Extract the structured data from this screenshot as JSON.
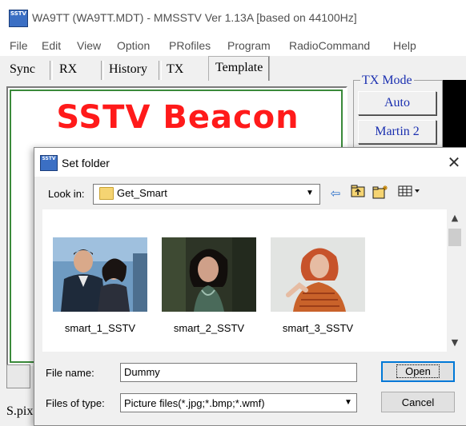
{
  "window": {
    "title": "WA9TT (WA9TT.MDT) - MMSSTV Ver 1.13A [based on 44100Hz]",
    "icon_text": "SSTV"
  },
  "menu": [
    "File",
    "Edit",
    "View",
    "Option",
    "PRofiles",
    "Program",
    "RadioCommand",
    "Help"
  ],
  "tabs": [
    "Sync",
    "RX",
    "History",
    "TX",
    "Template"
  ],
  "active_tab": "Template",
  "template": {
    "beacon_text": "SSTV Beacon"
  },
  "tx_mode": {
    "label": "TX Mode",
    "buttons": [
      "Auto",
      "Martin 2"
    ]
  },
  "status": {
    "spix_label": "S.pix"
  },
  "dialog": {
    "title": "Set folder",
    "icon_text": "SSTV",
    "look_in_label": "Look in:",
    "look_in_value": "Get_Smart",
    "files": [
      {
        "name": "smart_1_SSTV"
      },
      {
        "name": "smart_2_SSTV"
      },
      {
        "name": "smart_3_SSTV"
      }
    ],
    "file_name_label": "File name:",
    "file_name_value": "Dummy",
    "file_type_label": "Files of type:",
    "file_type_value": "Picture files(*.jpg;*.bmp;*.wmf)",
    "open_label": "Open",
    "cancel_label": "Cancel"
  },
  "colors": {
    "beacon_text": "#ff1a1a",
    "tx_mode_text": "#1a2fb0",
    "template_border": "#3a8a3a",
    "accent_focus": "#0078d7"
  },
  "icons": {
    "toolbar": [
      "back-arrow-icon",
      "up-folder-icon",
      "new-folder-icon",
      "view-menu-icon"
    ]
  }
}
